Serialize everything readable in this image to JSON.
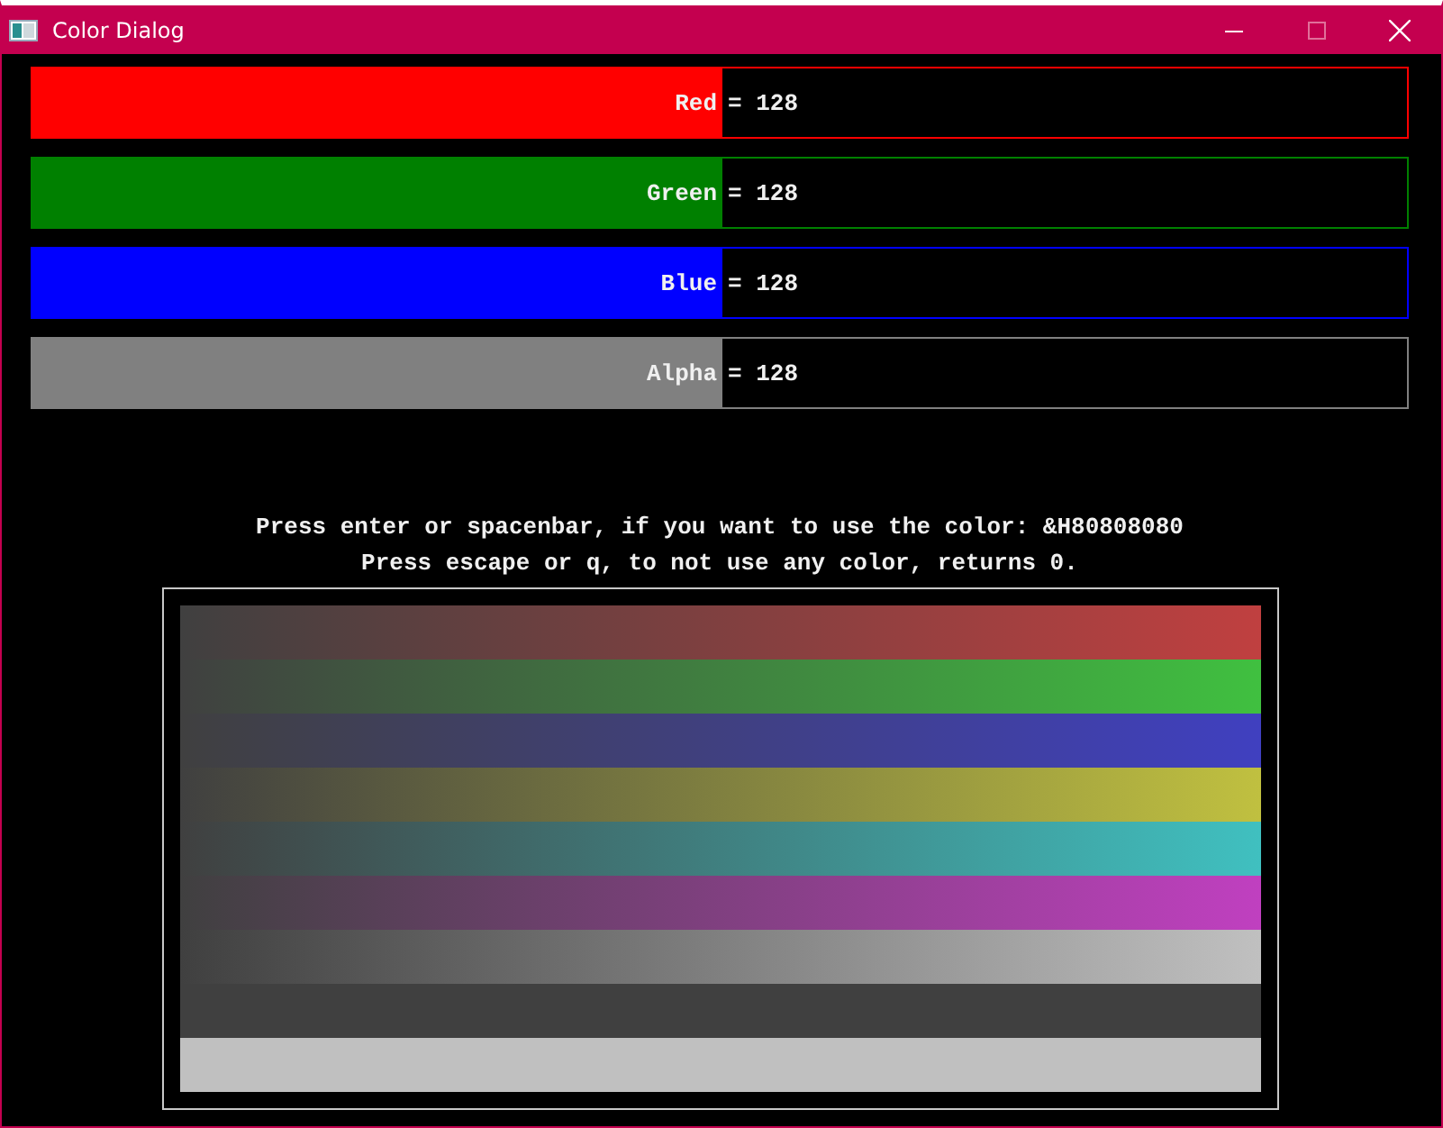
{
  "window": {
    "title": "Color Dialog"
  },
  "sliders": [
    {
      "label": "Red",
      "reading": "= 128",
      "level": 0.502,
      "color": "#ff0000"
    },
    {
      "label": "Green",
      "reading": "= 128",
      "level": 0.502,
      "color": "#008000"
    },
    {
      "label": "Blue",
      "reading": "= 128",
      "level": 0.502,
      "color": "#0000ff"
    },
    {
      "label": "Alpha",
      "reading": "= 128",
      "level": 0.502,
      "color": "#808080"
    }
  ],
  "messages": [
    "Press enter or spacenbar, if you want to use the color: &H80808080",
    "Press escape or q, to not use any color, returns 0."
  ],
  "swatches": [
    {
      "kind": "gradient",
      "color": "#c04040"
    },
    {
      "kind": "gradient",
      "color": "#40c040"
    },
    {
      "kind": "gradient",
      "color": "#4040c0"
    },
    {
      "kind": "gradient",
      "color": "#c0c040"
    },
    {
      "kind": "gradient",
      "color": "#40c0c0"
    },
    {
      "kind": "gradient",
      "color": "#c040c0"
    },
    {
      "kind": "gradient",
      "color": "#c0c0c0"
    },
    {
      "kind": "solid",
      "color": "#404040"
    },
    {
      "kind": "solid",
      "color": "#c0c0c0"
    }
  ]
}
